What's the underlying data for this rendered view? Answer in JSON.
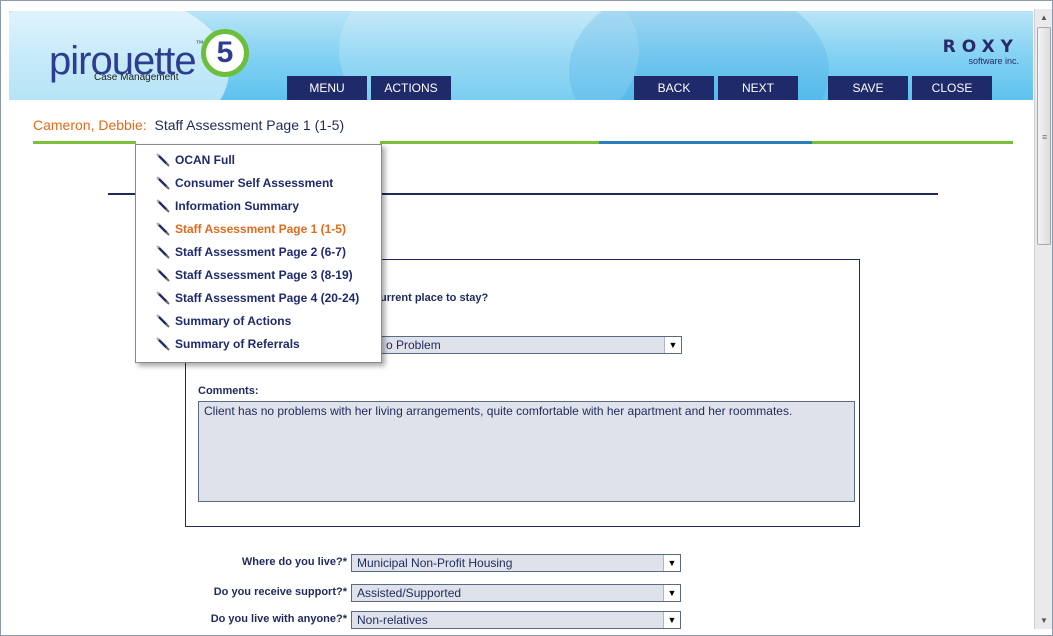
{
  "logo": {
    "name": "pirouette",
    "tm": "™",
    "version": "5",
    "subtitle": "Case Management"
  },
  "brand": {
    "name": "ROXY",
    "sub": "software inc."
  },
  "nav": {
    "menu": "MENU",
    "actions": "ACTIONS",
    "back": "BACK",
    "next": "NEXT",
    "save": "SAVE",
    "close": "CLOSE"
  },
  "breadcrumb": {
    "client": "Cameron, Debbie:",
    "page": "Staff Assessment Page 1 (1-5)"
  },
  "dropdown": {
    "items": [
      {
        "label": "OCAN Full",
        "active": false
      },
      {
        "label": "Consumer Self Assessment",
        "active": false
      },
      {
        "label": "Information Summary",
        "active": false
      },
      {
        "label": "Staff Assessment Page 1 (1-5)",
        "active": true
      },
      {
        "label": "Staff Assessment Page 2 (6-7)",
        "active": false
      },
      {
        "label": "Staff Assessment Page 3 (8-19)",
        "active": false
      },
      {
        "label": "Staff Assessment Page 4 (20-24)",
        "active": false
      },
      {
        "label": "Summary of Actions",
        "active": false
      },
      {
        "label": "Summary of Referrals",
        "active": false
      }
    ]
  },
  "section": {
    "question_partial": "urrent place to stay?",
    "rating_value": "o Problem",
    "comments_label": "Comments:",
    "comments_text": "Client has no problems with her living arrangements, quite comfortable with her apartment and her roommates."
  },
  "form": {
    "live_label": "Where do you live?*",
    "live_value": "Municipal Non-Profit Housing",
    "support_label": "Do you receive support?*",
    "support_value": "Assisted/Supported",
    "with_label": "Do you live with anyone?*",
    "with_value": "Non-relatives"
  },
  "colors": {
    "navy": "#1f2a6b",
    "orange": "#e06b1c",
    "green": "#7bbf3a",
    "blue": "#2a7fc0"
  }
}
